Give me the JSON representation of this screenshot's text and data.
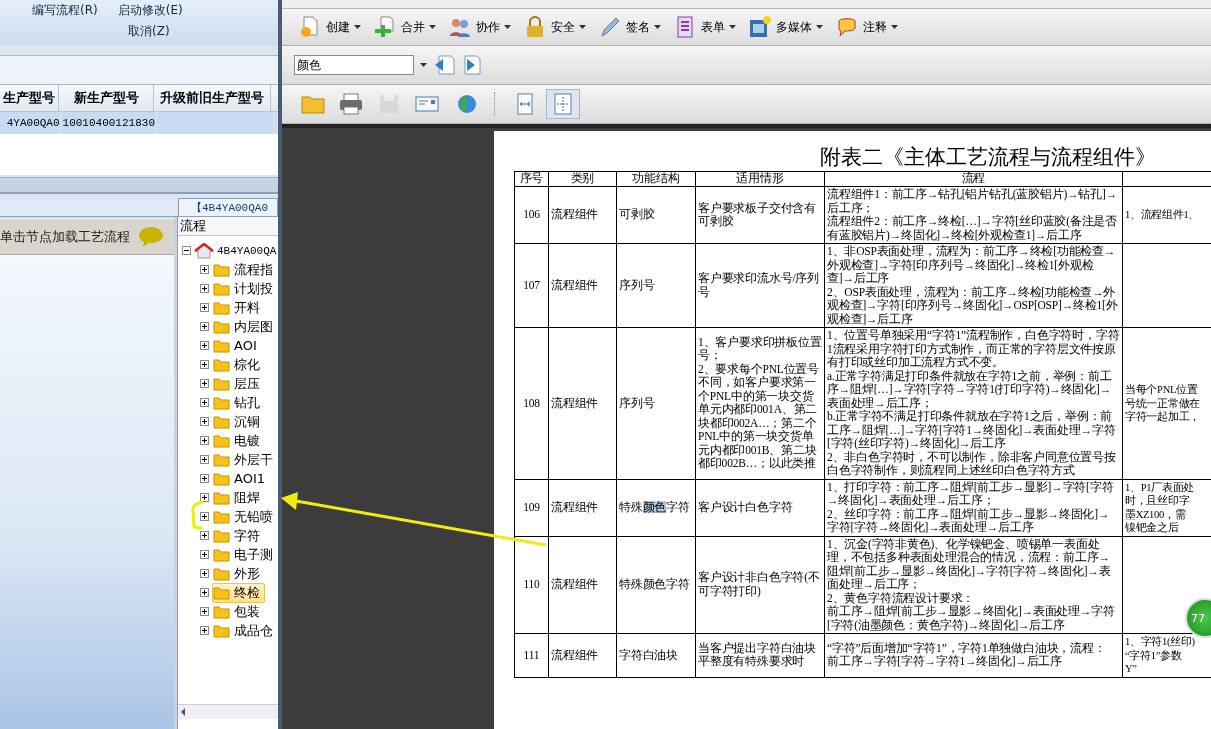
{
  "left_panel": {
    "ribbon_buttons": [
      {
        "label": "编写流程(R)"
      },
      {
        "label": "启动修改(E)"
      },
      {
        "label": "取消(Z)"
      }
    ],
    "grid": {
      "columns": [
        "生产型号",
        "新生产型号",
        "升级前旧生产型号"
      ],
      "rows": [
        {
          "cells": [
            "4YA00QA0",
            "10010400121830"
          ],
          "selected": true
        }
      ]
    },
    "tab": "【4B4YA00QA0",
    "hint": "单击节点加载工艺流程",
    "tree": {
      "header": "流程",
      "root": {
        "label": "4B4YA00QA",
        "expanded": true,
        "children": [
          {
            "label": "流程指",
            "expanded": false,
            "selected": false
          },
          {
            "label": "计划投",
            "expanded": false,
            "selected": false
          },
          {
            "label": "开料",
            "expanded": false,
            "selected": false
          },
          {
            "label": "内层图",
            "expanded": false,
            "selected": false
          },
          {
            "label": "AOI",
            "expanded": false,
            "selected": false
          },
          {
            "label": "棕化",
            "expanded": false,
            "selected": false
          },
          {
            "label": "层压",
            "expanded": false,
            "selected": false
          },
          {
            "label": "钻孔",
            "expanded": false,
            "selected": false
          },
          {
            "label": "沉铜",
            "expanded": false,
            "selected": false
          },
          {
            "label": "电镀",
            "expanded": false,
            "selected": false
          },
          {
            "label": "外层干",
            "expanded": false,
            "selected": false
          },
          {
            "label": "AOI1",
            "expanded": false,
            "selected": false
          },
          {
            "label": "阻焊",
            "expanded": false,
            "selected": false
          },
          {
            "label": "无铅喷",
            "expanded": false,
            "selected": false
          },
          {
            "label": "字符",
            "expanded": false,
            "selected": false
          },
          {
            "label": "电子测",
            "expanded": false,
            "selected": false
          },
          {
            "label": "外形",
            "expanded": false,
            "selected": false
          },
          {
            "label": "终检",
            "expanded": false,
            "selected": true
          },
          {
            "label": "包装",
            "expanded": false,
            "selected": false
          },
          {
            "label": "成品仓",
            "expanded": false,
            "selected": false
          }
        ]
      }
    }
  },
  "viewer": {
    "task_buttons": [
      {
        "label": "创建"
      },
      {
        "label": "合并"
      },
      {
        "label": "协作"
      },
      {
        "label": "安全"
      },
      {
        "label": "签名"
      },
      {
        "label": "表单"
      },
      {
        "label": "多媒体"
      },
      {
        "label": "注释"
      }
    ],
    "search_combo": {
      "value": "颜色"
    },
    "tools": [
      {
        "disabled": false,
        "selected": false
      },
      {
        "disabled": false,
        "selected": false
      },
      {
        "disabled": true,
        "selected": false
      },
      {
        "disabled": false,
        "selected": false
      },
      {
        "disabled": false,
        "selected": false
      },
      {
        "disabled": false,
        "selected": false
      },
      {
        "disabled": false,
        "selected": true
      }
    ],
    "document": {
      "title": "附表二《主体工艺流程与流程组件》",
      "table": {
        "columns": [
          "序号",
          "类别",
          "功能结构",
          "适用情形",
          "流程"
        ],
        "rows": [
          {
            "no": "106",
            "category": "流程组件",
            "function": [
              {
                "text": "可剥胶",
                "selected": false
              }
            ],
            "situation": "客户要求板子交付含有可剥胶",
            "flow": [
              "流程组件1：前工序→钻孔[铝片钻孔(蓝胶铝片)→钻孔]→后工序；",
              "流程组件2：前工序→终检[…]→字符[丝印蓝胶(备注是否有蓝胶铝片)→终固化]→终检[外观检查1]→后工序"
            ],
            "column_6": [
              "1、流程组件1、"
            ]
          },
          {
            "no": "107",
            "category": "流程组件",
            "function": [
              {
                "text": "序列号",
                "selected": false
              }
            ],
            "situation": "客户要求印流水号/序列号",
            "flow": [
              "1、非OSP表面处理，流程为：前工序→终检[功能检查→外观检查]→字符[印序列号→终固化]→终检1[外观检查]→后工序",
              "2、OSP表面处理，流程为：前工序→终检[功能检查→外观检查]→字符[印序列号→终固化]→OSP[OSP]→终检1[外观检查]→后工序"
            ]
          },
          {
            "no": "108",
            "category": "流程组件",
            "function": [
              {
                "text": "序列号",
                "selected": false
              }
            ],
            "situation": [
              "1、客户要求印拼板位置号；",
              "2、要求每个PNL位置号不同，如客户要求第一个PNL中的第一块交货单元内都印001A、第二块都印002A…；第二个PNL中的第一块交货单元内都印001B、第二块都印002B…；以此类推"
            ],
            "flow": [
              "1、位置号单独采用“字符1”流程制作，白色字符时，字符1流程采用字符打印方式制作，而正常的字符层文件按原有打印或丝印加工流程方式不变。",
              "a.正常字符满足打印条件就放在字符1之前，举例：前工序→阻焊[…]→字符[字符→字符1(打印字符)→终固化]→表面处理→后工序；",
              "b.正常字符不满足打印条件就放在字符1之后，举例：前工序→阻焊[…]→字符[字符1→终固化]→表面处理→字符[字符(丝印字符)→终固化]→后工序",
              "2、非白色字符时，不可以制作，除非客户同意位置号按白色字符制作，则流程同上述丝印白色字符方式"
            ],
            "column_6": [
              "当每个PNL位置",
              "号统一正常做在",
              "字符一起加工，"
            ]
          },
          {
            "no": "109",
            "category": "流程组件",
            "function": [
              {
                "text": "特殊",
                "selected": false
              },
              {
                "text": "颜色",
                "selected": true
              },
              {
                "text": "字符",
                "selected": false
              }
            ],
            "situation": "客户设计白色字符",
            "flow": [
              "1、打印字符：前工序→阻焊[前工步→显影]→字符[字符→终固化]→表面处理→后工序；",
              "2、丝印字符：前工序→阻焊[前工步→显影→终固化]→字符[字符→终固化]→表面处理→后工序"
            ],
            "column_6": [
              "1、P1厂表面处",
              "时，且丝印字",
              "墨XZ100，需",
              "镍钯金之后"
            ]
          },
          {
            "no": "110",
            "category": "流程组件",
            "function": [
              {
                "text": "特殊颜色字符",
                "selected": false
              }
            ],
            "situation": "客户设计非白色字符(不可字符打印)",
            "flow": [
              "1、沉金(字符非黄色)、化学镍钯金、喷锡单一表面处理，不包括多种表面处理混合的情况，流程：前工序→阻焊[前工步→显影→终固化]→字符[字符→终固化]→表面处理→后工序；",
              "2、黄色字符流程设计要求：",
              "前工序→阻焊[前工步→显影→终固化]→表面处理→字符[字符(油墨颜色：黄色字符)→终固化]→后工序"
            ]
          },
          {
            "no": "111",
            "category": "流程组件",
            "function": [
              {
                "text": "字符白油块",
                "selected": false
              }
            ],
            "situation": "当客户提出字符白油块平整度有特殊要求时",
            "flow": [
              "“字符”后面增加“字符1”，字符1单独做白油块，流程：",
              "前工序→字符[字符→字符1→终固化]→后工序"
            ],
            "column_6": [
              "1、字符1(丝印)",
              "“字符1”参数",
              "Y”"
            ]
          }
        ]
      }
    }
  },
  "badge": "77"
}
